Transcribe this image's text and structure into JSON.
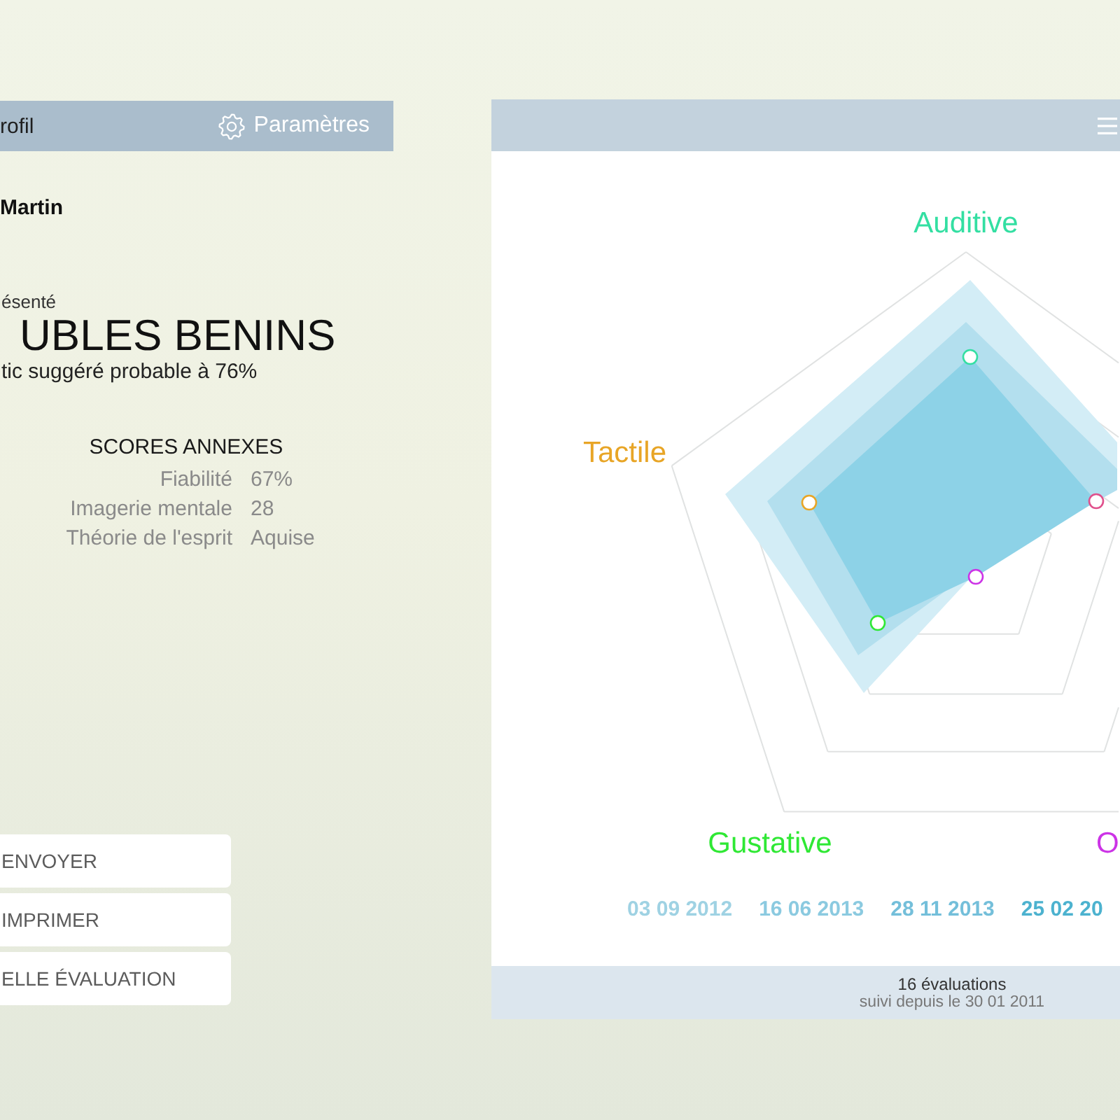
{
  "profile_panel": {
    "header": {
      "title": "rofil",
      "settings_label": "Paramètres"
    },
    "patient_name": "Martin",
    "diagnosis": {
      "label": "ésenté",
      "title": "UBLES BENINS",
      "subtitle": "tic suggéré probable à 76%"
    },
    "scores": {
      "title": "SCORES ANNEXES",
      "rows": [
        {
          "label": "Fiabilité",
          "value": "67%"
        },
        {
          "label": "Imagerie mentale",
          "value": "28"
        },
        {
          "label": "Théorie de l'esprit",
          "value": "Aquise"
        }
      ]
    },
    "actions": [
      "ENVOYER",
      "IMPRIMER",
      "ELLE ÉVALUATION"
    ]
  },
  "chart_panel": {
    "axes": [
      {
        "label": "Auditive",
        "color": "#33dfa2"
      },
      {
        "color": "#e0508c"
      },
      {
        "label": "O",
        "color": "#cc33e6"
      },
      {
        "label": "Gustative",
        "color": "#2fe834"
      },
      {
        "label": "Tactile",
        "color": "#e8a526"
      }
    ],
    "dates": [
      {
        "text": "03 09 2012",
        "color": "#9fd2e3"
      },
      {
        "text": "16 06 2013",
        "color": "#8bcae0"
      },
      {
        "text": "28 11 2013",
        "color": "#74bfda"
      },
      {
        "text": "25 02 20",
        "color": "#4cb2cf"
      }
    ],
    "footer": {
      "count": "16 évaluations",
      "since": "suivi depuis le 30 01 2011"
    }
  }
}
